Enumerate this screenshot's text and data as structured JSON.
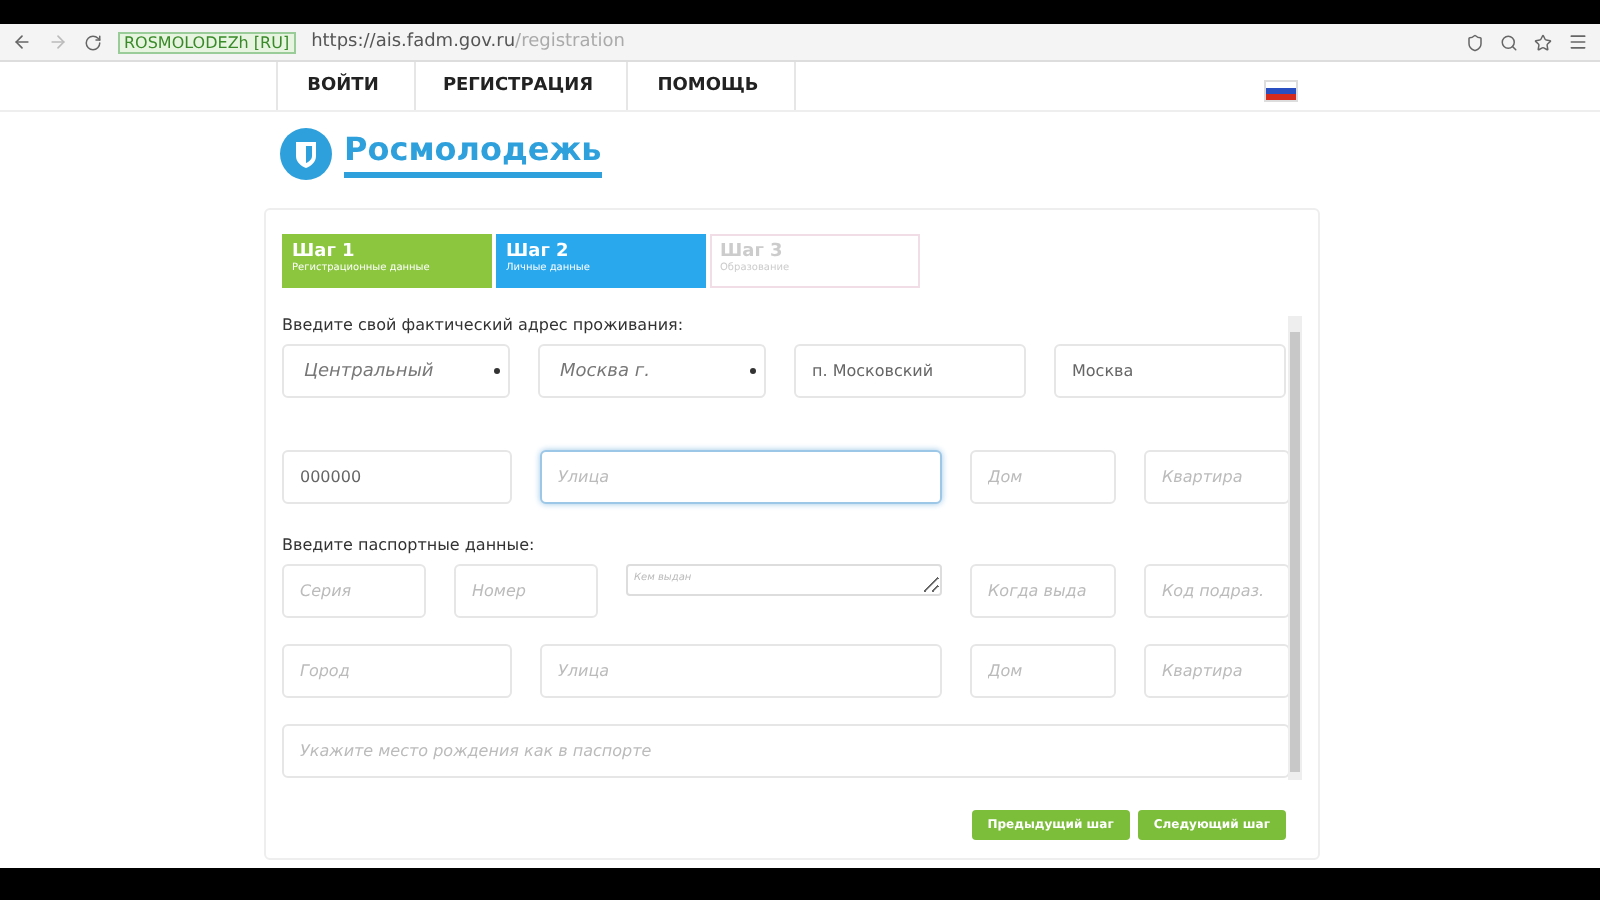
{
  "browser": {
    "site_badge": "ROSMOLODEZh [RU]",
    "url_host": "https://ais.fadm.gov.ru",
    "url_path": "/registration"
  },
  "nav": [
    {
      "label": "ВОЙТИ"
    },
    {
      "label": "РЕГИСТРАЦИЯ"
    },
    {
      "label": "ПОМОЩЬ"
    }
  ],
  "logo": {
    "text": "Росмолодежь"
  },
  "steps": [
    {
      "title": "Шаг 1",
      "subtitle": "Регистрационные данные",
      "selected": false
    },
    {
      "title": "Шаг 2",
      "subtitle": "Личные данные",
      "selected": true
    },
    {
      "title": "Шаг 3",
      "subtitle": "Образование",
      "selected": false
    }
  ],
  "sections": [
    {
      "label": "Введите свой фактический адрес проживания:",
      "rows": [
        {
          "fields": [
            {
              "kind": "select",
              "value": "Центральный"
            },
            {
              "kind": "select",
              "value": "Москва г."
            },
            {
              "kind": "input",
              "value": "п. Московский"
            },
            {
              "kind": "input",
              "value": "Москва"
            }
          ]
        },
        {
          "fields": [
            {
              "kind": "input",
              "value": "000000"
            },
            {
              "kind": "input",
              "placeholder": "Улица",
              "focused": true
            },
            {
              "kind": "input",
              "placeholder": "Дом"
            },
            {
              "kind": "input",
              "placeholder": "Квартира"
            }
          ]
        }
      ]
    },
    {
      "label": "Введите паспортные данные:",
      "rows": [
        {
          "fields": [
            {
              "kind": "input",
              "placeholder": "Серия"
            },
            {
              "kind": "input",
              "placeholder": "Номер"
            },
            {
              "kind": "textarea",
              "placeholder": "Кем выдан"
            },
            {
              "kind": "input",
              "placeholder": "Когда выда"
            },
            {
              "kind": "input",
              "placeholder": "Код подраз."
            }
          ]
        },
        {
          "fields": [
            {
              "kind": "input",
              "placeholder": "Город"
            },
            {
              "kind": "input",
              "placeholder": "Улица"
            },
            {
              "kind": "input",
              "placeholder": "Дом"
            },
            {
              "kind": "input",
              "placeholder": "Квартира"
            }
          ]
        },
        {
          "fields": [
            {
              "kind": "input",
              "placeholder": "Укажите место рождения как в паспорте"
            }
          ]
        }
      ]
    }
  ],
  "buttons": [
    "Предыдущий шаг",
    "Следующий шаг"
  ]
}
